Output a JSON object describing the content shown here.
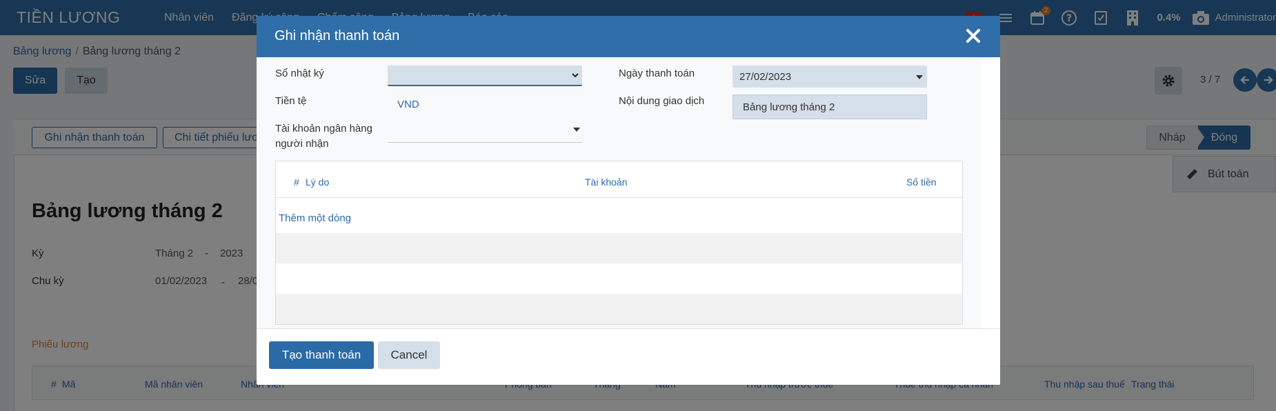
{
  "navbar": {
    "brand": "TIỀN LƯƠNG",
    "menu": [
      "Nhân viên",
      "Đăng ký công",
      "Chấm công",
      "Bảng lương",
      "Báo cáo"
    ],
    "badge_count": "2",
    "percent": "0.4%",
    "user": "Administrator"
  },
  "breadcrumb": {
    "parent": "Bảng lương",
    "current": "Bảng lương tháng 2"
  },
  "toolbar": {
    "edit_label": "Sửa",
    "create_label": "Tạo"
  },
  "pager": {
    "value": "3 / 7"
  },
  "statusbar": {
    "buttons": [
      "Ghi nhận thanh toán",
      "Chi tiết phiếu lươ"
    ],
    "stages": [
      "Nháp",
      "Đóng"
    ],
    "active_stage": "Đóng"
  },
  "smart_button": {
    "label": "Bút toán"
  },
  "form": {
    "title": "Bảng lương tháng 2",
    "period_label": "Kỳ",
    "period_month": "Tháng 2",
    "period_dash": "-",
    "period_year": "2023",
    "cycle_label": "Chu kỳ",
    "cycle_from": "01/02/2023",
    "cycle_dash": "-",
    "cycle_to": "28/0",
    "section_label": "Phiếu lương"
  },
  "list": {
    "columns": [
      "#",
      "Mã",
      "Mã nhân viên",
      "Nhân viên",
      "Phòng ban",
      "Tháng",
      "Năm",
      "Thu nhập trước thuế",
      "Thuế thu nhập cá nhân",
      "Thu nhập sau thuế",
      "Trạng thái"
    ]
  },
  "modal": {
    "title": "Ghi nhận thanh toán",
    "journal_label": "Sổ nhật ký",
    "journal_value": "",
    "currency_label": "Tiền tệ",
    "currency_value": "VND",
    "bank_label_line1": "Tài khoản ngân hàng",
    "bank_label_line2": "người nhận",
    "bank_value": "",
    "date_label": "Ngày thanh toán",
    "date_value": "27/02/2023",
    "memo_label": "Nội dung giao dịch",
    "memo_value": "Bảng lương tháng 2",
    "table": {
      "headers": [
        "#",
        "Lý do",
        "Tài khoản",
        "Số tiền"
      ],
      "add_line": "Thêm một dòng"
    },
    "submit_label": "Tạo thanh toán",
    "cancel_label": "Cancel"
  },
  "colors": {
    "primary": "#2f6ea8",
    "accent_orange": "#d9822b"
  }
}
